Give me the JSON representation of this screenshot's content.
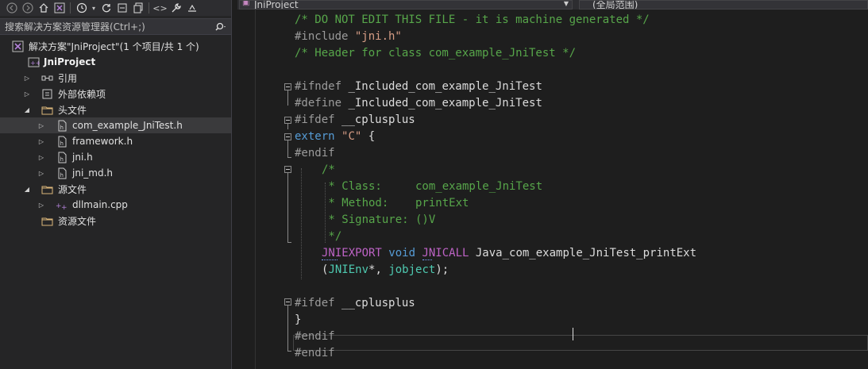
{
  "solution_explorer": {
    "search_placeholder": "搜索解决方案资源管理器(Ctrl+;)",
    "search_icon": "magnifier-icon",
    "solution_label": "解决方案\"JniProject\"(1 个项目/共 1 个)",
    "project_name": "JniProject",
    "references": "引用",
    "external_deps": "外部依赖项",
    "header_files": "头文件",
    "header_items": [
      "com_example_JniTest.h",
      "framework.h",
      "jni.h",
      "jni_md.h"
    ],
    "source_files": "源文件",
    "source_items": [
      "dllmain.cpp"
    ],
    "resource_files": "资源文件"
  },
  "editor": {
    "nav_project": "JniProject",
    "nav_scope": "(全局范围)"
  },
  "code": {
    "l1_comment": "/* DO NOT EDIT THIS FILE - it is machine generated */",
    "l2_include": "#include ",
    "l2_file": "\"jni.h\"",
    "l3_comment": "/* Header for class com_example_JniTest */",
    "l5_pre": "#ifndef ",
    "l5_name": "_Included_com_example_JniTest",
    "l6_pre": "#define ",
    "l6_name": "_Included_com_example_JniTest",
    "l7_pre": "#ifdef ",
    "l7_name": "__cplusplus",
    "l8_kw": "extern ",
    "l8_str": "\"C\"",
    "l8_brace": " {",
    "l9_pre": "#endif",
    "l10": "/*",
    "l11": " * Class:     com_example_JniTest",
    "l12": " * Method:    printExt",
    "l13": " * Signature: ()V",
    "l14": " */",
    "l15_macro1": "JNIEXPORT",
    "l15_kw": " void ",
    "l15_macro2": "JNICALL",
    "l15_fn": " Java_com_example_JniTest_printExt",
    "l16_open": "(",
    "l16_type": "JNIEnv",
    "l16_mid": "*, ",
    "l16_type2": "jobject",
    "l16_close": ");",
    "l18_pre": "#ifdef ",
    "l18_name": "__cplusplus",
    "l19": "}",
    "l20_pre": "#endif",
    "l21_pre": "#endif"
  }
}
